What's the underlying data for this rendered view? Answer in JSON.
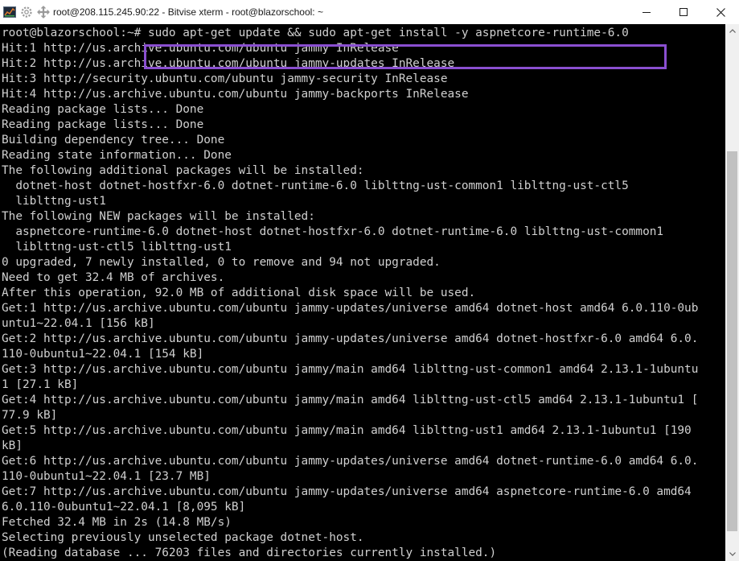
{
  "window": {
    "title": "root@208.115.245.90:22 - Bitvise xterm - root@blazorschool: ~"
  },
  "icons": {
    "app": "bitvise-terminal-icon",
    "settings": "gear-icon",
    "move": "move-arrows-icon",
    "minimize": "minimize-icon",
    "maximize": "maximize-icon",
    "close": "close-icon"
  },
  "terminal": {
    "lines": [
      "root@blazorschool:~# sudo apt-get update && sudo apt-get install -y aspnetcore-runtime-6.0",
      "Hit:1 http://us.archive.ubuntu.com/ubuntu jammy InRelease",
      "Hit:2 http://us.archive.ubuntu.com/ubuntu jammy-updates InRelease",
      "Hit:3 http://security.ubuntu.com/ubuntu jammy-security InRelease",
      "Hit:4 http://us.archive.ubuntu.com/ubuntu jammy-backports InRelease",
      "Reading package lists... Done",
      "Reading package lists... Done",
      "Building dependency tree... Done",
      "Reading state information... Done",
      "The following additional packages will be installed:",
      "  dotnet-host dotnet-hostfxr-6.0 dotnet-runtime-6.0 liblttng-ust-common1 liblttng-ust-ctl5",
      "  liblttng-ust1",
      "The following NEW packages will be installed:",
      "  aspnetcore-runtime-6.0 dotnet-host dotnet-hostfxr-6.0 dotnet-runtime-6.0 liblttng-ust-common1",
      "  liblttng-ust-ctl5 liblttng-ust1",
      "0 upgraded, 7 newly installed, 0 to remove and 94 not upgraded.",
      "Need to get 32.4 MB of archives.",
      "After this operation, 92.0 MB of additional disk space will be used.",
      "Get:1 http://us.archive.ubuntu.com/ubuntu jammy-updates/universe amd64 dotnet-host amd64 6.0.110-0ub",
      "untu1~22.04.1 [156 kB]",
      "Get:2 http://us.archive.ubuntu.com/ubuntu jammy-updates/universe amd64 dotnet-hostfxr-6.0 amd64 6.0.",
      "110-0ubuntu1~22.04.1 [154 kB]",
      "Get:3 http://us.archive.ubuntu.com/ubuntu jammy/main amd64 liblttng-ust-common1 amd64 2.13.1-1ubuntu",
      "1 [27.1 kB]",
      "Get:4 http://us.archive.ubuntu.com/ubuntu jammy/main amd64 liblttng-ust-ctl5 amd64 2.13.1-1ubuntu1 [",
      "77.9 kB]",
      "Get:5 http://us.archive.ubuntu.com/ubuntu jammy/main amd64 liblttng-ust1 amd64 2.13.1-1ubuntu1 [190",
      "kB]",
      "Get:6 http://us.archive.ubuntu.com/ubuntu jammy-updates/universe amd64 dotnet-runtime-6.0 amd64 6.0.",
      "110-0ubuntu1~22.04.1 [23.7 MB]",
      "Get:7 http://us.archive.ubuntu.com/ubuntu jammy-updates/universe amd64 aspnetcore-runtime-6.0 amd64",
      "6.0.110-0ubuntu1~22.04.1 [8,095 kB]",
      "Fetched 32.4 MB in 2s (14.8 MB/s)",
      "Selecting previously unselected package dotnet-host.",
      "(Reading database ... 76203 files and directories currently installed.)"
    ]
  },
  "colors": {
    "highlight": "#8a4fd0",
    "terminal_bg": "#000000",
    "terminal_fg": "#d0d0d0"
  }
}
